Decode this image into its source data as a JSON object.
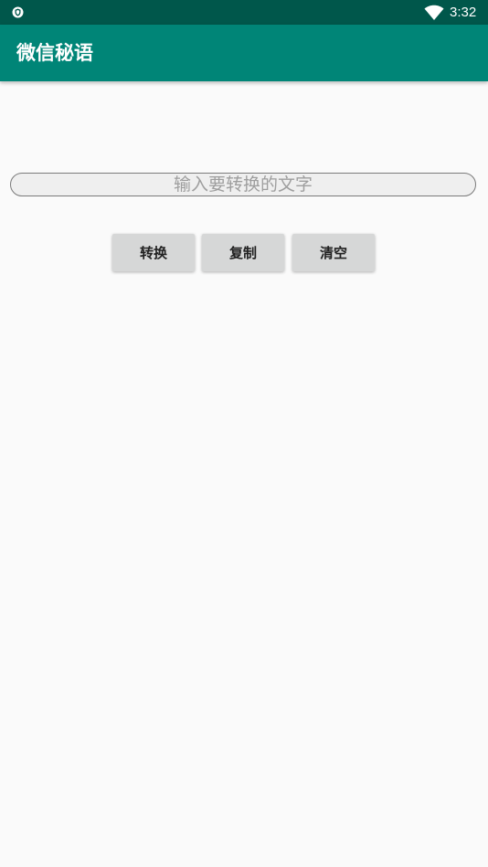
{
  "status_bar": {
    "left_icon": "shield-icon",
    "wifi_icon": "wifi-icon",
    "time": "3:32"
  },
  "app_bar": {
    "title": "微信秘语"
  },
  "input": {
    "value": "",
    "placeholder": "输入要转换的文字"
  },
  "buttons": {
    "convert": "转换",
    "copy": "复制",
    "clear": "清空"
  },
  "colors": {
    "status_bar": "#00574b",
    "app_bar": "#008577",
    "background": "#fafafa",
    "button": "#d6d7d7"
  }
}
